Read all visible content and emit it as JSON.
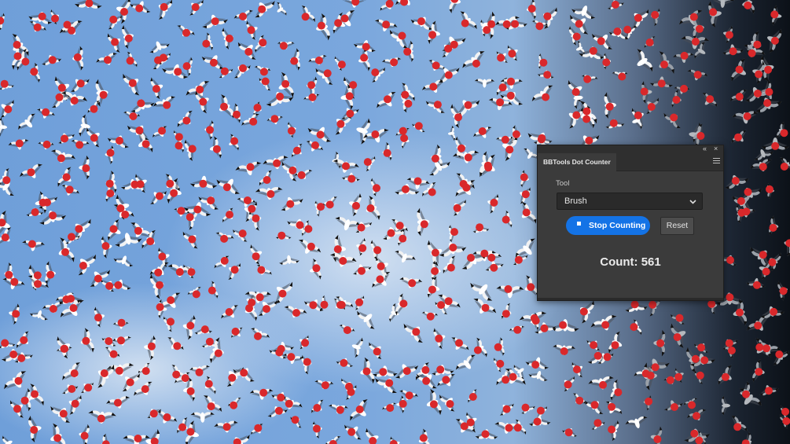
{
  "panel": {
    "title": "BBTools Dot Counter",
    "collapse_glyph": "«",
    "close_glyph": "×",
    "menu_icon": "hamburger-menu-icon",
    "tool_label": "Tool",
    "tool_value": "Brush",
    "stop_label": "Stop Counting",
    "stop_icon": "stop-square-icon",
    "reset_label": "Reset",
    "count_text": "Count: 561"
  },
  "colors": {
    "dot": "#d9282b",
    "primary_button": "#1473e6",
    "panel_bg": "#3b3b3b"
  }
}
